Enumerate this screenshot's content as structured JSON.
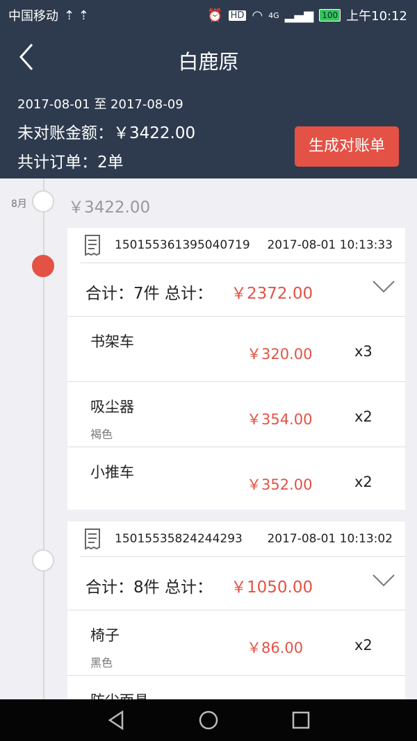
{
  "status_bar": {
    "carrier": "中国移动",
    "usb_icons": "⇡ ⇡",
    "network": "4G",
    "battery": "100",
    "time": "上午10:12"
  },
  "header": {
    "title": "白鹿原"
  },
  "summary": {
    "date_range": "2017-08-01 至 2017-08-09",
    "unpaid_amount": "未对账金额：￥3422.00",
    "total_orders": "共计订单：2单",
    "generate_button": "生成对账单"
  },
  "month_group": {
    "month": "8月",
    "total": "￥3422.00"
  },
  "orders": [
    {
      "order_no": "150155361395040719",
      "time": "2017-08-01 10:13:33",
      "total_label": "合计：7件  总计：",
      "total_amount": "￥2372.00",
      "items": [
        {
          "name": "书架车",
          "spec": "",
          "price": "￥320.00",
          "qty": "x3"
        },
        {
          "name": "吸尘器",
          "spec": "褐色",
          "price": "￥354.00",
          "qty": "x2"
        },
        {
          "name": "小推车",
          "spec": "",
          "price": "￥352.00",
          "qty": "x2"
        }
      ]
    },
    {
      "order_no": "15015535824244293",
      "time": "2017-08-01 10:13:02",
      "total_label": "合计：8件  总计：",
      "total_amount": "￥1050.00",
      "items": [
        {
          "name": "椅子",
          "spec": "黑色",
          "price": "￥86.00",
          "qty": "x2"
        },
        {
          "name": "防尘面具",
          "spec": "",
          "price": "",
          "qty": ""
        }
      ]
    }
  ],
  "colors": {
    "header_bg": "#2e3b4e",
    "accent_red": "#e35245",
    "background": "#efeff4"
  }
}
